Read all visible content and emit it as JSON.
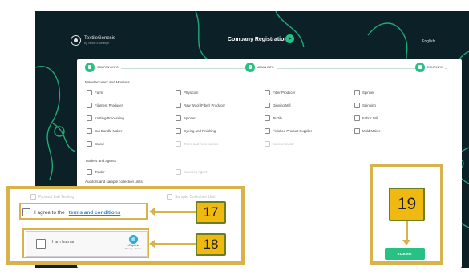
{
  "header": {
    "brand": "TextileGenesis",
    "brand_sub": "by Textile Exchange",
    "title": "Company Registration",
    "language": "English"
  },
  "steps": [
    {
      "label": "COMPANY INFO"
    },
    {
      "label": "ADMIN INFO"
    },
    {
      "label": "ROLE INFO"
    }
  ],
  "sections": {
    "manufacturers": "Manufacturers and Mossers",
    "traders": "Traders and agents",
    "auditors": "Auditors and sample collection units"
  },
  "options": [
    [
      "Farm",
      "Physician",
      "Fiber Producer",
      "Spinner"
    ],
    [
      "Filament Producer",
      "Raw Wool (Fiber) Producer",
      "Ginning Mill",
      "Spinning"
    ],
    [
      "Knitting/Processing",
      "Spinner",
      "Textile",
      "Fabric Mill"
    ],
    [
      "Cut Bundle Maker",
      "Dyeing and Finishing",
      "Finished Product Supplier",
      "Mold Maker"
    ],
    [
      "Brand",
      "Trims and Accessories",
      "Subcontractor"
    ]
  ],
  "trader_options": [
    "Trader",
    "Sourcing Agent"
  ],
  "auditor_options": [
    "Product Lab Testing",
    "Sample Collection Unit"
  ],
  "terms": {
    "prefix": "I agree to the",
    "link": "terms and conditions"
  },
  "captcha": {
    "label": "I am human",
    "brand": "hCaptcha",
    "links": "Privacy · Terms"
  },
  "callouts": {
    "c17": "17",
    "c18": "18",
    "c19": "19"
  },
  "submit_label": "SUBMIT"
}
